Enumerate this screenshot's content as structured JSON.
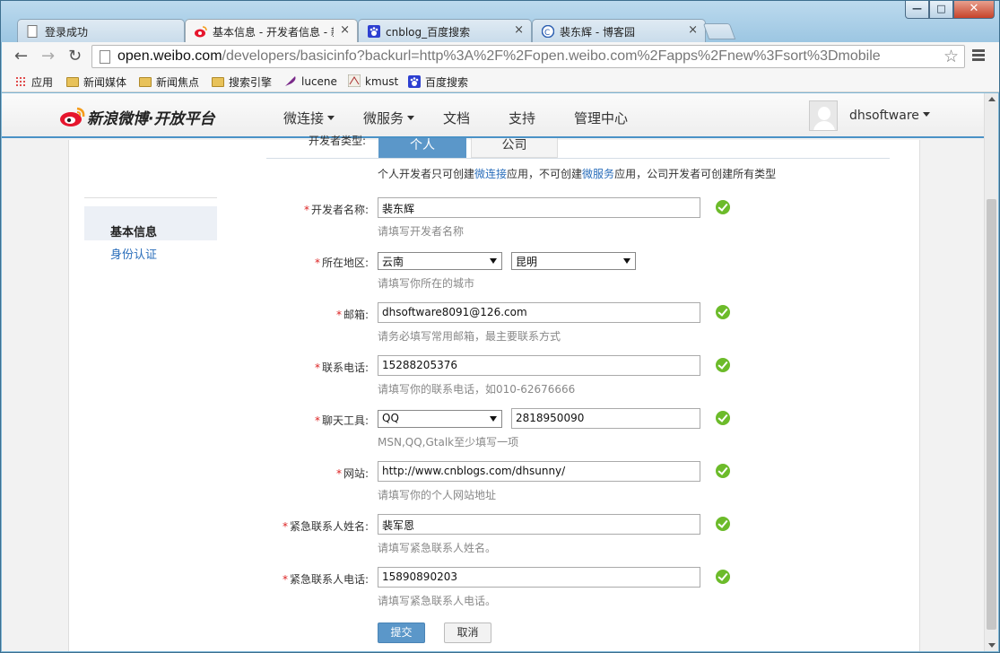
{
  "window": {
    "controls": {
      "minimize": "—",
      "maximize": "□",
      "close": "✕"
    }
  },
  "tabs": [
    {
      "title": "登录成功",
      "icon": "page-icon"
    },
    {
      "title": "基本信息 - 开发者信息 - 新",
      "icon": "weibo-icon",
      "active": true
    },
    {
      "title": "cnblog_百度搜索",
      "icon": "baidu-paw-icon"
    },
    {
      "title": "裴东辉 - 博客园",
      "icon": "cnblogs-icon"
    }
  ],
  "tab_close": "×",
  "toolbar": {
    "url_host": "open.weibo.com",
    "url_path": "/developers/basicinfo?backurl=http%3A%2F%2Fopen.weibo.com%2Fapps%2Fnew%3Fsort%3Dmobile",
    "back": "←",
    "forward": "→",
    "reload": "↻",
    "star": "☆"
  },
  "bookmarks": [
    {
      "label": "应用",
      "icon": "apps-icon"
    },
    {
      "label": "新闻媒体",
      "icon": "folder-icon"
    },
    {
      "label": "新闻焦点",
      "icon": "folder-icon"
    },
    {
      "label": "搜索引擎",
      "icon": "folder-icon"
    },
    {
      "label": "lucene",
      "icon": "feather-icon"
    },
    {
      "label": "kmust",
      "icon": "kmust-icon"
    },
    {
      "label": "百度搜索",
      "icon": "baidu-paw-icon"
    }
  ],
  "header": {
    "logo_text": "新浪微博·开放平台",
    "nav": [
      {
        "label": "微连接",
        "dropdown": true
      },
      {
        "label": "微服务",
        "dropdown": true
      },
      {
        "label": "文档",
        "dropdown": false
      },
      {
        "label": "支持",
        "dropdown": false
      },
      {
        "label": "管理中心",
        "dropdown": false
      }
    ],
    "username": "dhsoftware"
  },
  "sidebar": {
    "items": [
      {
        "label": "基本信息",
        "selected": true
      },
      {
        "label": "身份认证",
        "selected": false
      }
    ]
  },
  "form": {
    "dev_type_label": "开发者类型:",
    "dev_types": [
      "个人",
      "公司"
    ],
    "type_note": {
      "a": "个人开发者只可创建",
      "link1": "微连接",
      "b": "应用，不可创建",
      "link2": "微服务",
      "c": "应用，公司开发者可创建所有类型"
    },
    "required_mark": "*",
    "fields": {
      "name": {
        "label": "开发者名称:",
        "value": "裴东辉",
        "hint": "请填写开发者名称"
      },
      "region": {
        "label": "所在地区:",
        "province": "云南",
        "city": "昆明",
        "hint": "请填写你所在的城市"
      },
      "email": {
        "label": "邮箱:",
        "value": "dhsoftware8091@126.com",
        "hint": "请务必填写常用邮箱，最主要联系方式"
      },
      "phone": {
        "label": "联系电话:",
        "value": "15288205376",
        "hint": "请填写你的联系电话，如010-62676666"
      },
      "chat": {
        "label": "聊天工具:",
        "tool": "QQ",
        "value": "2818950090",
        "hint": "MSN,QQ,Gtalk至少填写一项"
      },
      "website": {
        "label": "网站:",
        "value": "http://www.cnblogs.com/dhsunny/",
        "hint": "请填写你的个人网站地址"
      },
      "emergency_name": {
        "label": "紧急联系人姓名:",
        "value": "裴军恩",
        "hint": "请填写紧急联系人姓名。"
      },
      "emergency_phone": {
        "label": "紧急联系人电话:",
        "value": "15890890203",
        "hint": "请填写紧急联系人电话。"
      }
    },
    "submit": "提交",
    "cancel": "取消"
  },
  "colors": {
    "accent": "#5b97c9",
    "valid": "#6cbb2a",
    "required": "#dd2222",
    "link": "#2a6ebb"
  }
}
